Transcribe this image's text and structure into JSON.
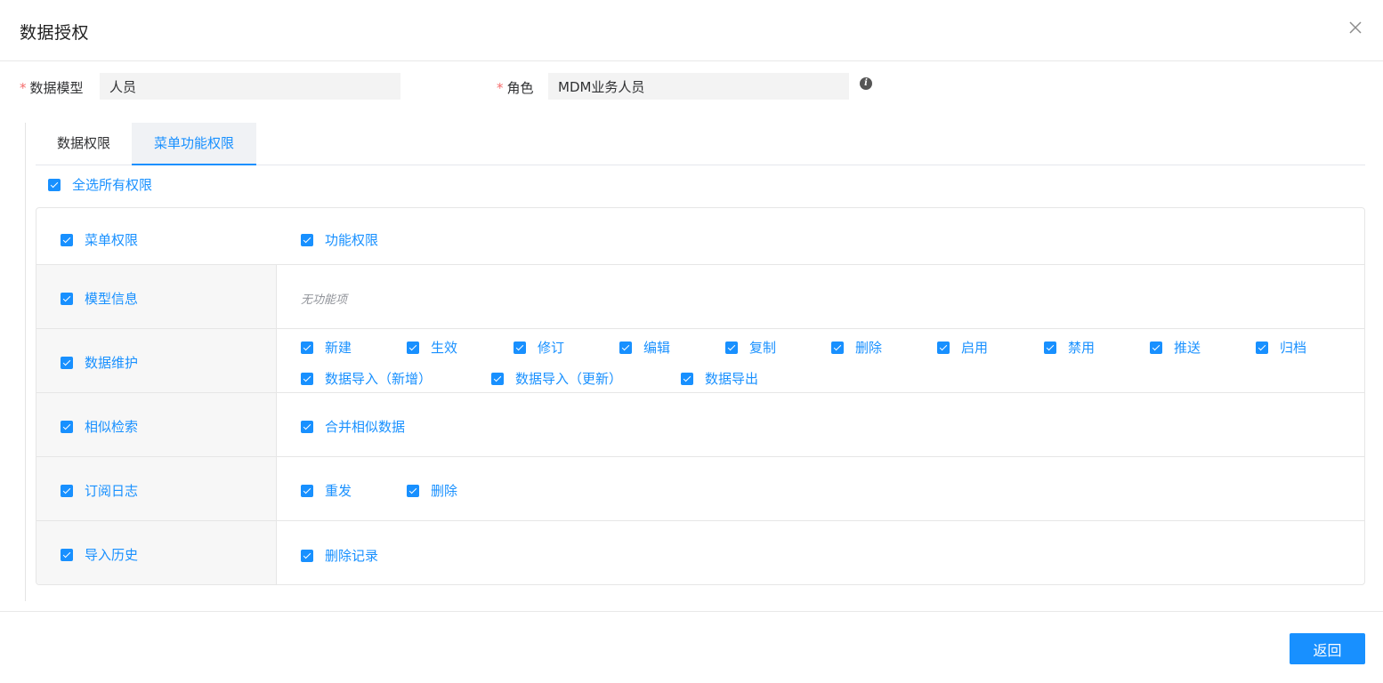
{
  "dialog": {
    "title": "数据授权"
  },
  "form": {
    "model_label": "数据模型",
    "model_value": "人员",
    "role_label": "角色",
    "role_value": "MDM业务人员",
    "required_mark": "*"
  },
  "tabs": [
    {
      "label": "数据权限",
      "active": false
    },
    {
      "label": "菜单功能权限",
      "active": true
    }
  ],
  "select_all": {
    "label": "全选所有权限",
    "checked": true
  },
  "table": {
    "header": {
      "menu": "菜单权限",
      "func": "功能权限"
    },
    "rows": [
      {
        "menu": "模型信息",
        "checked": true,
        "empty_text": "无功能项",
        "funcs": []
      },
      {
        "menu": "数据维护",
        "checked": true,
        "funcs": [
          "新建",
          "生效",
          "修订",
          "编辑",
          "复制",
          "删除",
          "启用",
          "禁用",
          "推送",
          "归档",
          "数据导入（新增）",
          "数据导入（更新）",
          "数据导出"
        ]
      },
      {
        "menu": "相似检索",
        "checked": true,
        "funcs": [
          "合并相似数据"
        ]
      },
      {
        "menu": "订阅日志",
        "checked": true,
        "funcs": [
          "重发",
          "删除"
        ]
      },
      {
        "menu": "导入历史",
        "checked": true,
        "funcs": [
          "删除记录"
        ]
      }
    ]
  },
  "footer": {
    "back_label": "返回"
  },
  "colors": {
    "accent": "#1890ff",
    "required": "#f56c6c"
  }
}
